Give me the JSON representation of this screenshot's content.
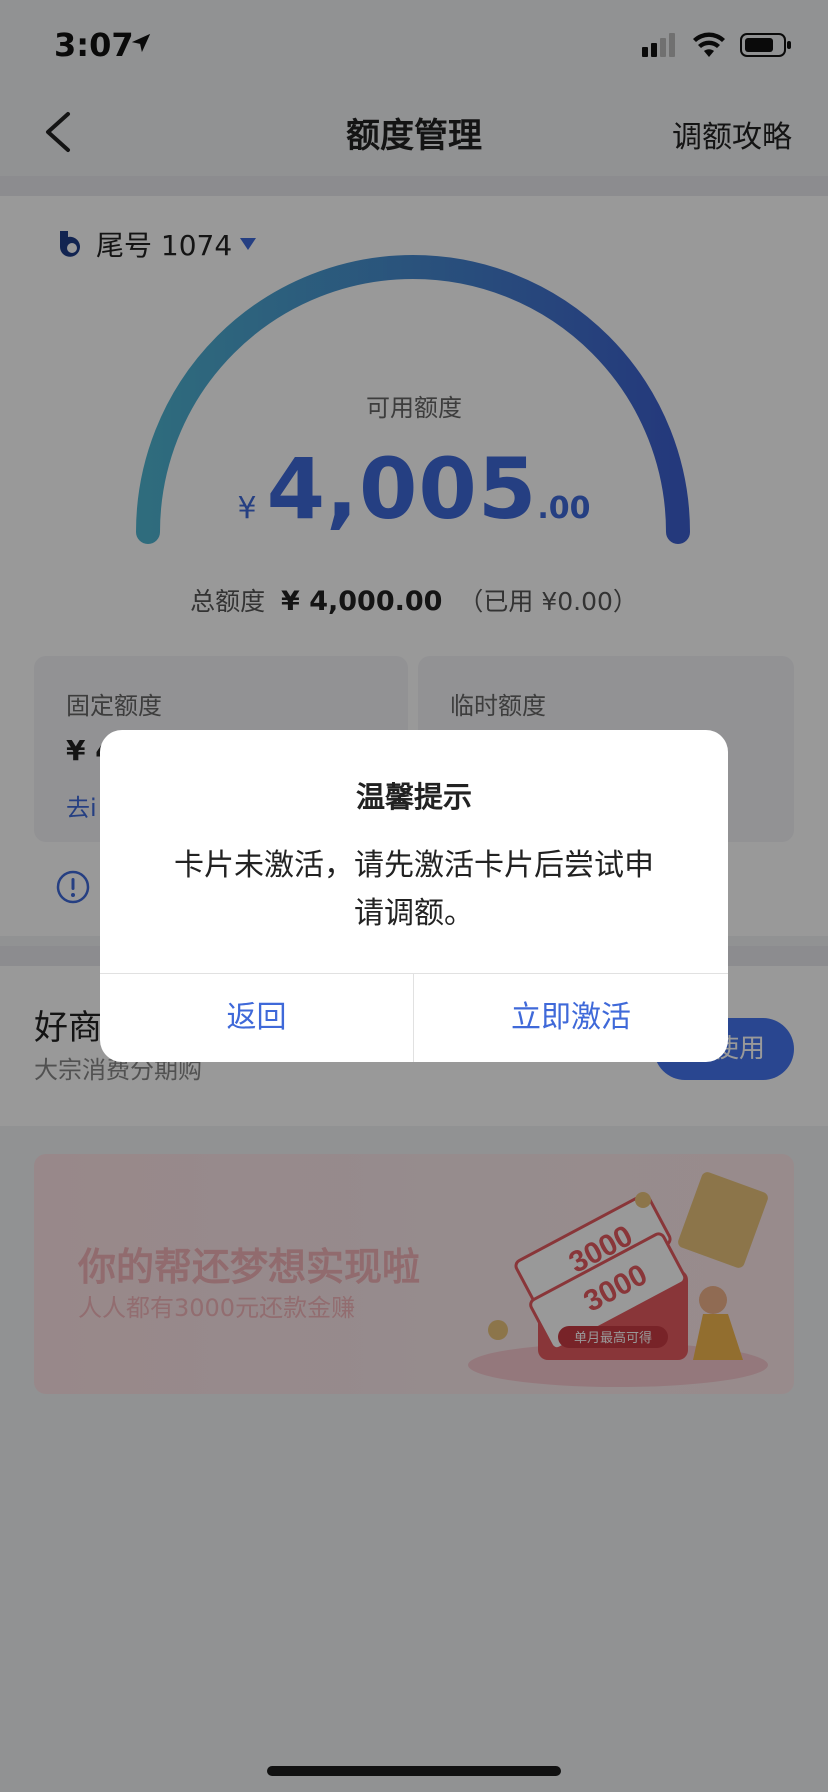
{
  "status_bar": {
    "time": "3:07"
  },
  "nav": {
    "title": "额度管理",
    "right_action": "调额攻略"
  },
  "account": {
    "label": "尾号 1074"
  },
  "credit": {
    "available_label": "可用额度",
    "currency": "¥",
    "available_int": "4,005",
    "available_dec": ".00",
    "total_label": "总额度",
    "total_value": "¥ 4,000.00",
    "used_text": "（已用 ¥0.00）"
  },
  "boxes": {
    "fixed": {
      "label": "固定额度",
      "value_partial": "¥ 4",
      "link_partial": "去i"
    },
    "temp": {
      "label": "临时额度"
    }
  },
  "promo": {
    "title_partial": "好商",
    "subtitle_partial": "大宗消费分期购",
    "button_partial": "使用"
  },
  "banner": {
    "title": "你的帮还梦想实现啦",
    "subtitle": "人人都有3000元还款金赚",
    "ticket_text": "3000",
    "tag_text": "单月最高可得"
  },
  "dialog": {
    "title": "温馨提示",
    "message": "卡片未激活，请先激活卡片后尝试申请调额。",
    "cancel_label": "返回",
    "confirm_label": "立即激活"
  },
  "colors": {
    "accent": "#3f69d9",
    "button_blue": "#4576f0",
    "gauge_start": "#4fb4d0",
    "gauge_end": "#3d5fcf"
  }
}
